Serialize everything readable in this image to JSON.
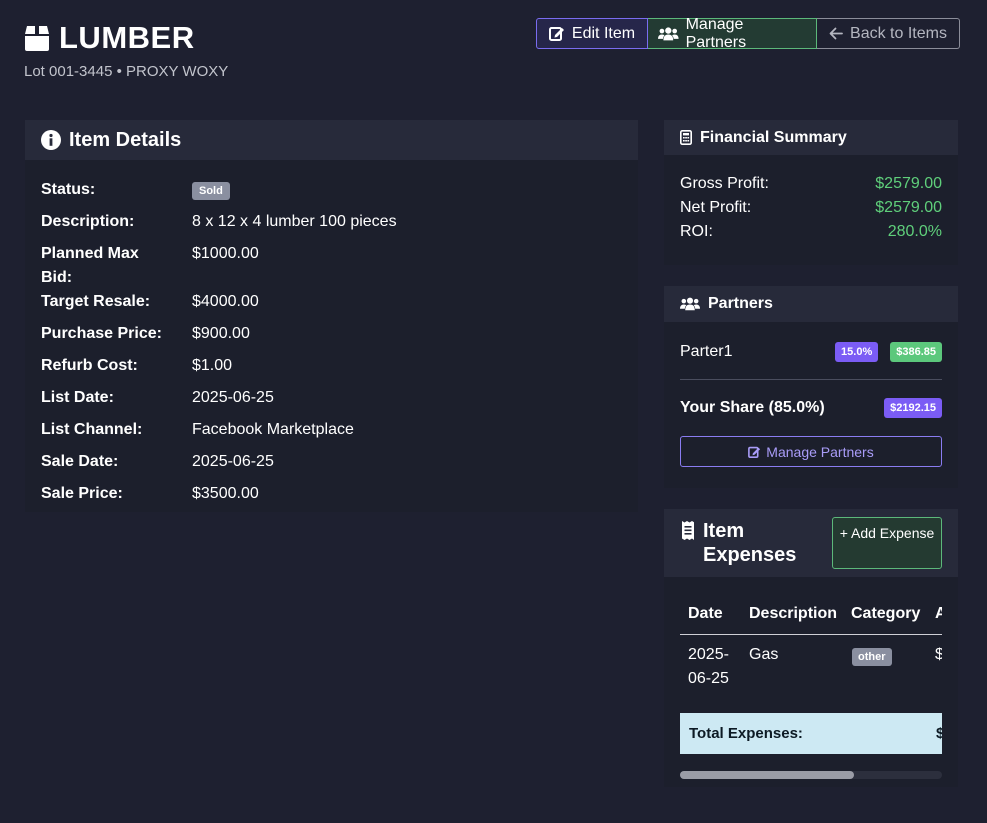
{
  "header": {
    "title": "LUMBER",
    "subtitle": "Lot 001-3445 • PROXY WOXY",
    "icon": "box-icon"
  },
  "actions": {
    "edit_label": "Edit Item",
    "manage_partners_label": "Manage Partners",
    "back_label": "Back to Items"
  },
  "details": {
    "title": "Item Details",
    "rows": [
      {
        "label": "Status:",
        "value": "Sold"
      },
      {
        "label": "Description:",
        "value": "8 x 12 x 4 lumber 100 pieces"
      },
      {
        "label": "Planned Max Bid:",
        "value": "$1000.00"
      },
      {
        "label": "Target Resale:",
        "value": "$4000.00"
      },
      {
        "label": "Purchase Price:",
        "value": "$900.00"
      },
      {
        "label": "Refurb Cost:",
        "value": "$1.00"
      },
      {
        "label": "List Date:",
        "value": "2025-06-25"
      },
      {
        "label": "List Channel:",
        "value": "Facebook Marketplace"
      },
      {
        "label": "Sale Date:",
        "value": "2025-06-25"
      },
      {
        "label": "Sale Price:",
        "value": "$3500.00"
      }
    ]
  },
  "financial": {
    "title": "Financial Summary",
    "rows": [
      {
        "label": "Gross Profit:",
        "value": "$2579.00"
      },
      {
        "label": "Net Profit:",
        "value": "$2579.00"
      },
      {
        "label": "ROI:",
        "value": "280.0%"
      }
    ]
  },
  "partners": {
    "title": "Partners",
    "list": [
      {
        "name": "Parter1",
        "share": "15.0%",
        "amount": "$386.85"
      }
    ],
    "your_share_label": "Your Share (85.0%)",
    "your_share_amount": "$2192.15",
    "manage_label": "Manage Partners"
  },
  "expenses": {
    "title": "Item Expenses",
    "add_label": "+ Add Expense",
    "columns": [
      "Date",
      "Description",
      "Category",
      "A"
    ],
    "rows": [
      {
        "date": "2025-06-25",
        "description": "Gas",
        "category": "other",
        "amount_cut": "$"
      }
    ],
    "total_label": "Total Expenses:",
    "total_cut": "$"
  },
  "colors": {
    "background": "#1e2030",
    "accent_purple": "#7b5cf5",
    "accent_green": "#5fcf7b"
  }
}
